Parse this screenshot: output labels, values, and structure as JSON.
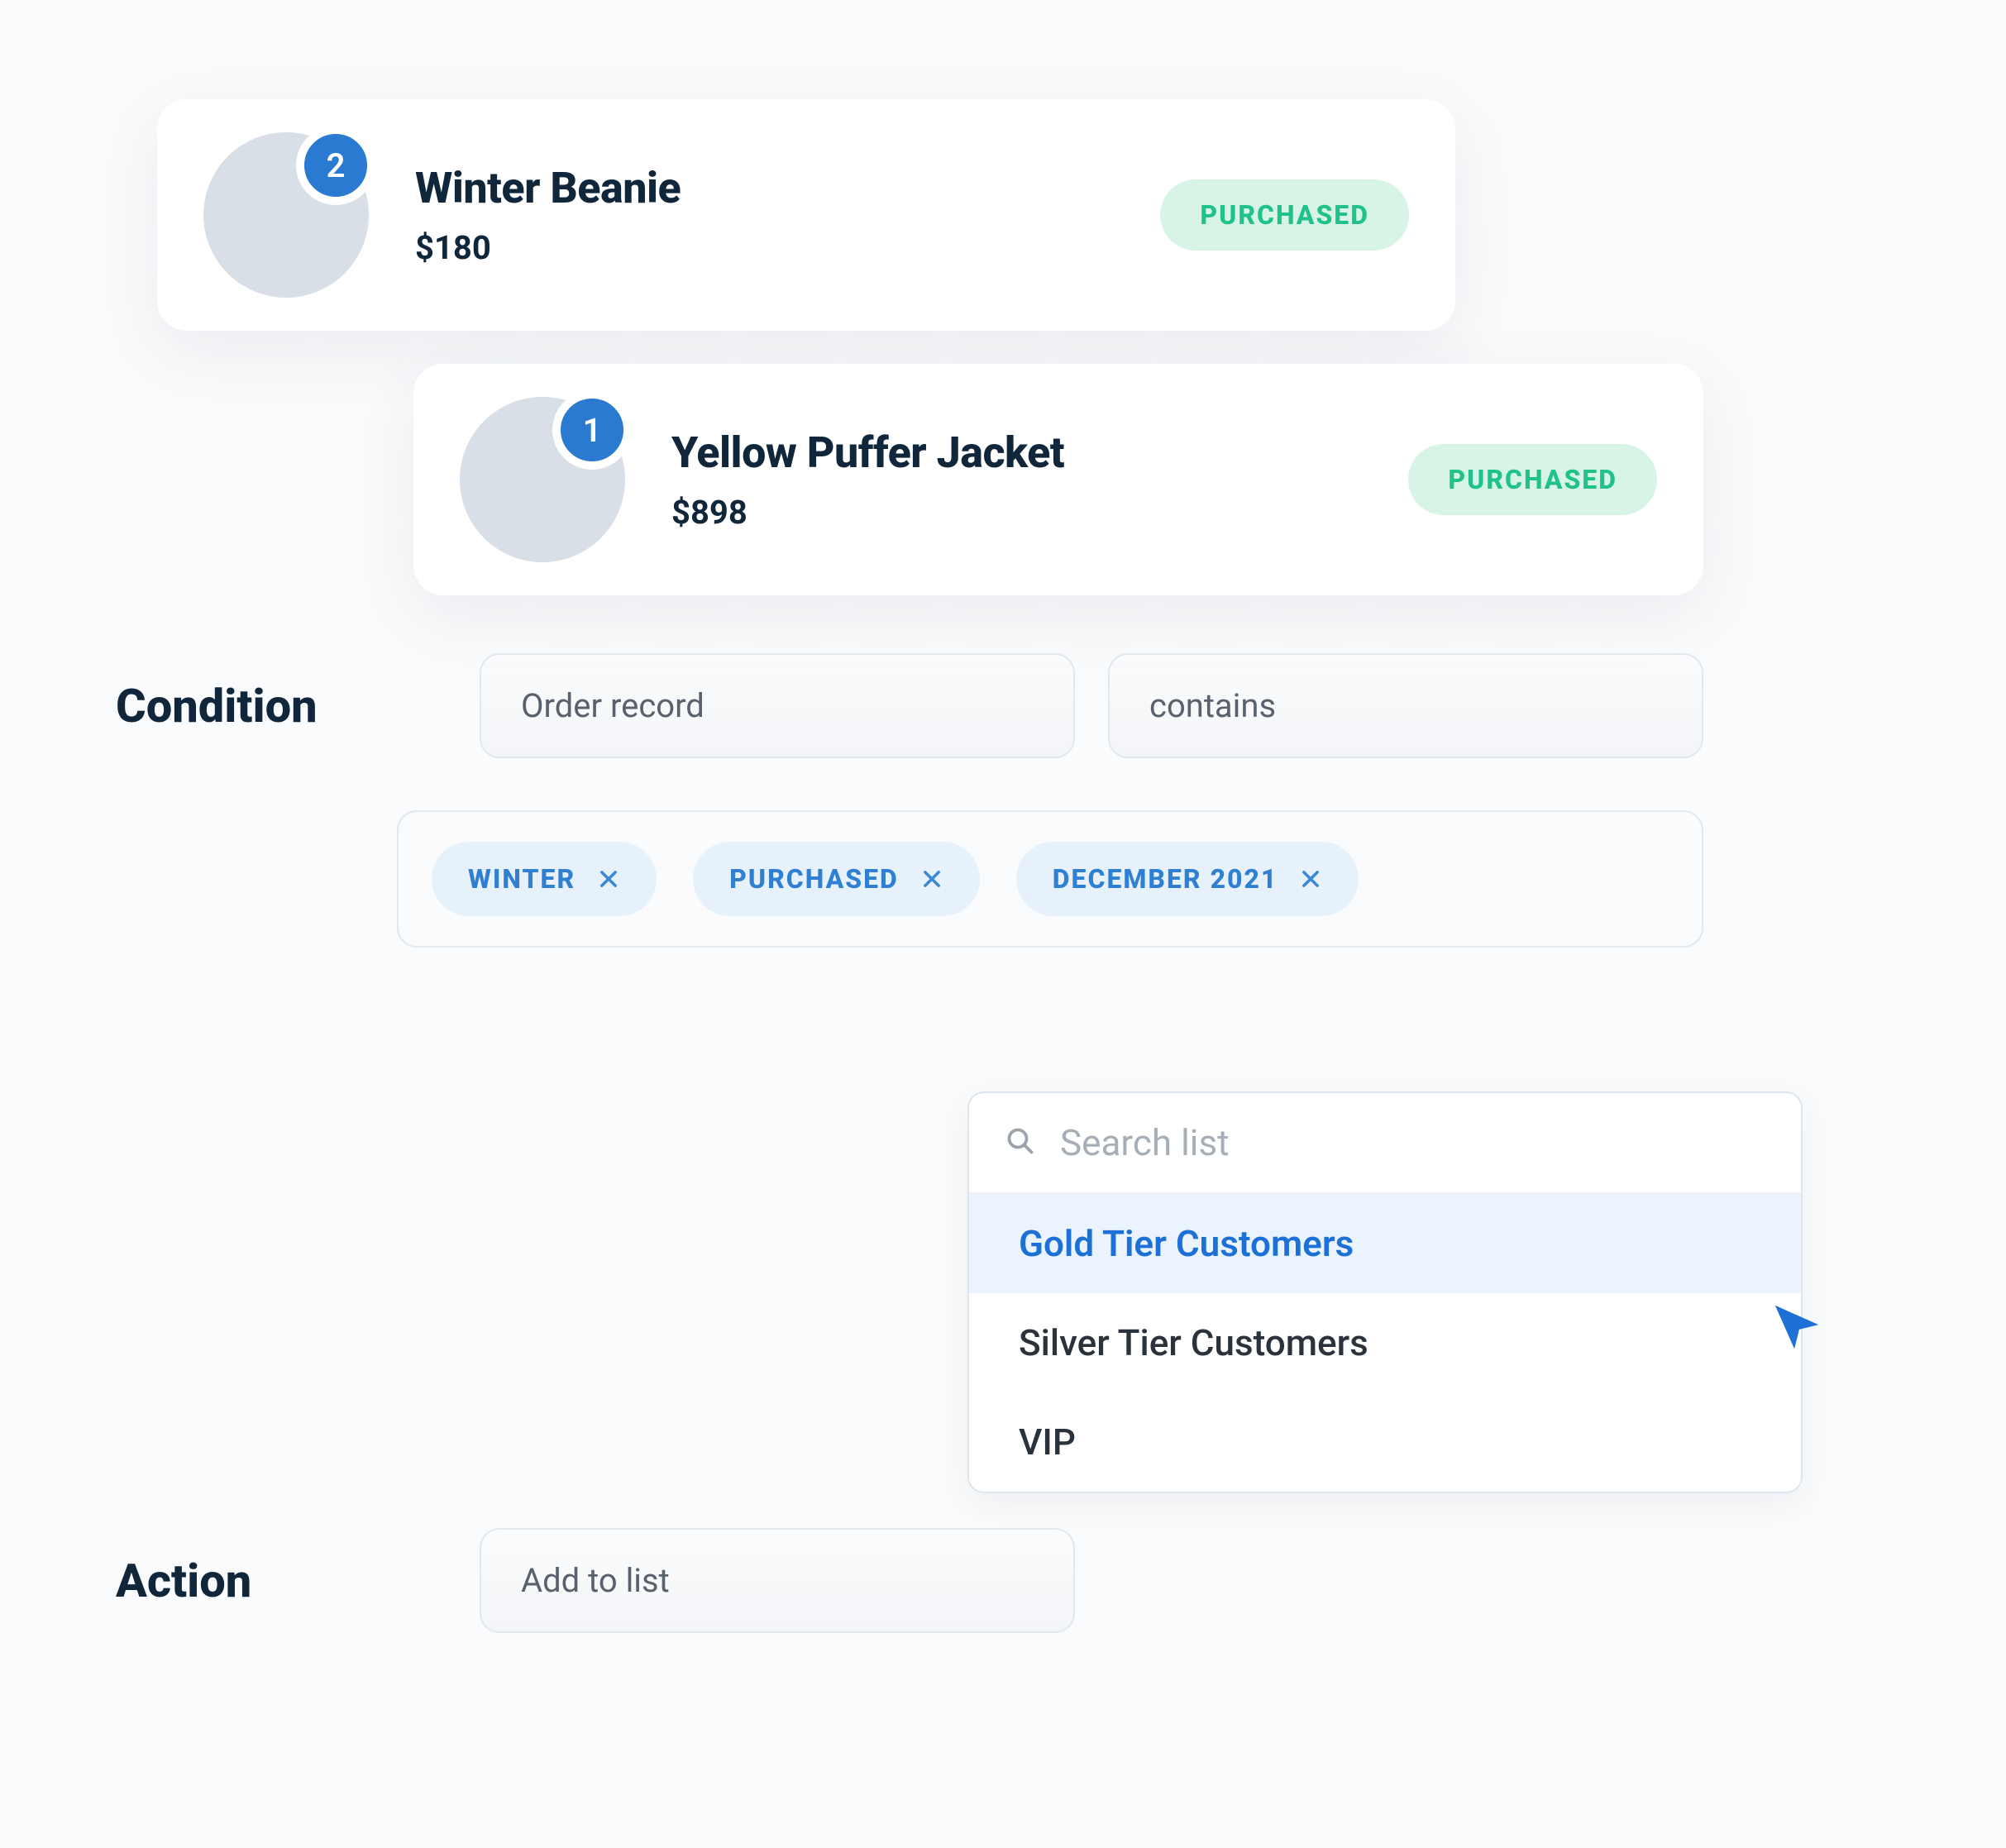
{
  "products": [
    {
      "name": "Winter Beanie",
      "price": "$180",
      "count": "2",
      "status": "PURCHASED"
    },
    {
      "name": "Yellow Puffer Jacket",
      "price": "$898",
      "count": "1",
      "status": "PURCHASED"
    }
  ],
  "condition": {
    "label": "Condition",
    "field_select": "Order record",
    "operator_select": "contains",
    "tags": [
      "WINTER",
      "PURCHASED",
      "DECEMBER 2021"
    ]
  },
  "action": {
    "label": "Action",
    "select": "Add to list"
  },
  "list_picker": {
    "search_placeholder": "Search list",
    "options": [
      {
        "label": "Gold Tier Customers",
        "selected": true
      },
      {
        "label": "Silver Tier Customers",
        "selected": false
      },
      {
        "label": "VIP",
        "selected": false
      }
    ]
  }
}
